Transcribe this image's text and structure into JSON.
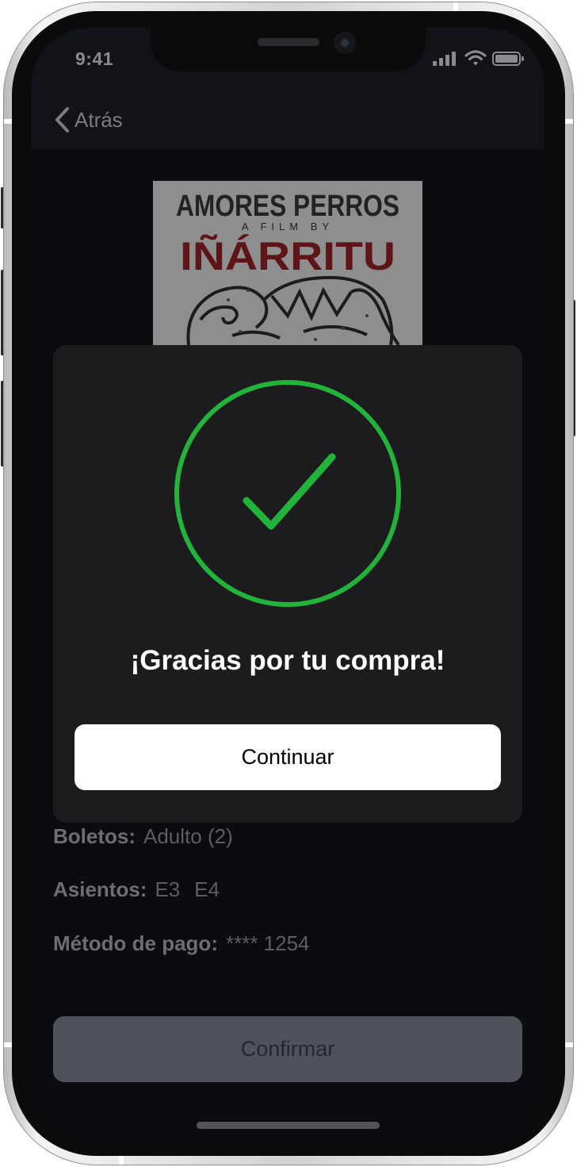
{
  "status_bar": {
    "time": "9:41"
  },
  "nav": {
    "back_label": "Atrás"
  },
  "poster": {
    "title_line": "AMORES PERROS",
    "sub_line": "A FILM BY",
    "director_line": "IÑÁRRITU"
  },
  "details": {
    "tickets": {
      "label": "Boletos:",
      "value": "Adulto (2)"
    },
    "seats": {
      "label": "Asientos:",
      "values": [
        "E3",
        "E4"
      ]
    },
    "payment": {
      "label": "Método de pago:",
      "value": "**** 1254"
    }
  },
  "confirm_label": "Confirmar",
  "modal": {
    "title": "¡Gracias por tu compra!",
    "button_label": "Continuar",
    "icon": "checkmark-circle-icon",
    "accent_color": "#22b33a"
  }
}
